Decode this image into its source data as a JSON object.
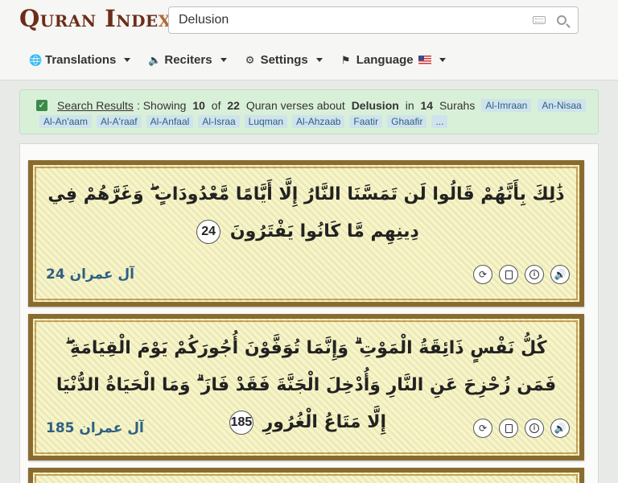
{
  "header": {
    "logo": "Quran Inde",
    "logo_x": "x",
    "search_value": "Delusion"
  },
  "nav": [
    {
      "icon": "globe-icon",
      "label": "Translations"
    },
    {
      "icon": "speaker-icon",
      "label": "Reciters"
    },
    {
      "icon": "gear-icon",
      "label": "Settings"
    },
    {
      "icon": "flag-icon",
      "label": "Language"
    }
  ],
  "banner": {
    "link": "Search Results",
    "t1": ": Showing ",
    "shown": "10",
    "t2": " of ",
    "total": "22",
    "t3": " Quran verses about ",
    "query": "Delusion",
    "t4": " in ",
    "surahs": "14",
    "t5": " Surahs",
    "tags_line1": [
      "Al-Imraan",
      "An-Nisaa"
    ],
    "tags_line2": [
      "Al-An'aam",
      "Al-A'raaf",
      "Al-Anfaal",
      "Al-Israa",
      "Luqman",
      "Al-Ahzaab",
      "Faatir",
      "Ghaafir",
      "..."
    ]
  },
  "verses": [
    {
      "text": "ذَٰلِكَ بِأَنَّهُمْ قَالُوا لَن تَمَسَّنَا النَّارُ إِلَّا أَيَّامًا مَّعْدُودَاتٍ ۖ وَغَرَّهُمْ فِي دِينِهِم مَّا كَانُوا يَفْتَرُونَ",
      "number": "24",
      "ref": "آل عمران 24"
    },
    {
      "text": "كُلُّ نَفْسٍ ذَائِقَةُ الْمَوْتِ ۗ وَإِنَّمَا تُوَفَّوْنَ أُجُورَكُمْ يَوْمَ الْقِيَامَةِ ۖ فَمَن زُحْزِحَ عَنِ النَّارِ وَأُدْخِلَ الْجَنَّةَ فَقَدْ فَازَ ۗ وَمَا الْحَيَاةُ الدُّنْيَا إِلَّا مَتَاعُ الْغُرُورِ",
      "number": "185",
      "ref": "آل عمران 185"
    }
  ]
}
